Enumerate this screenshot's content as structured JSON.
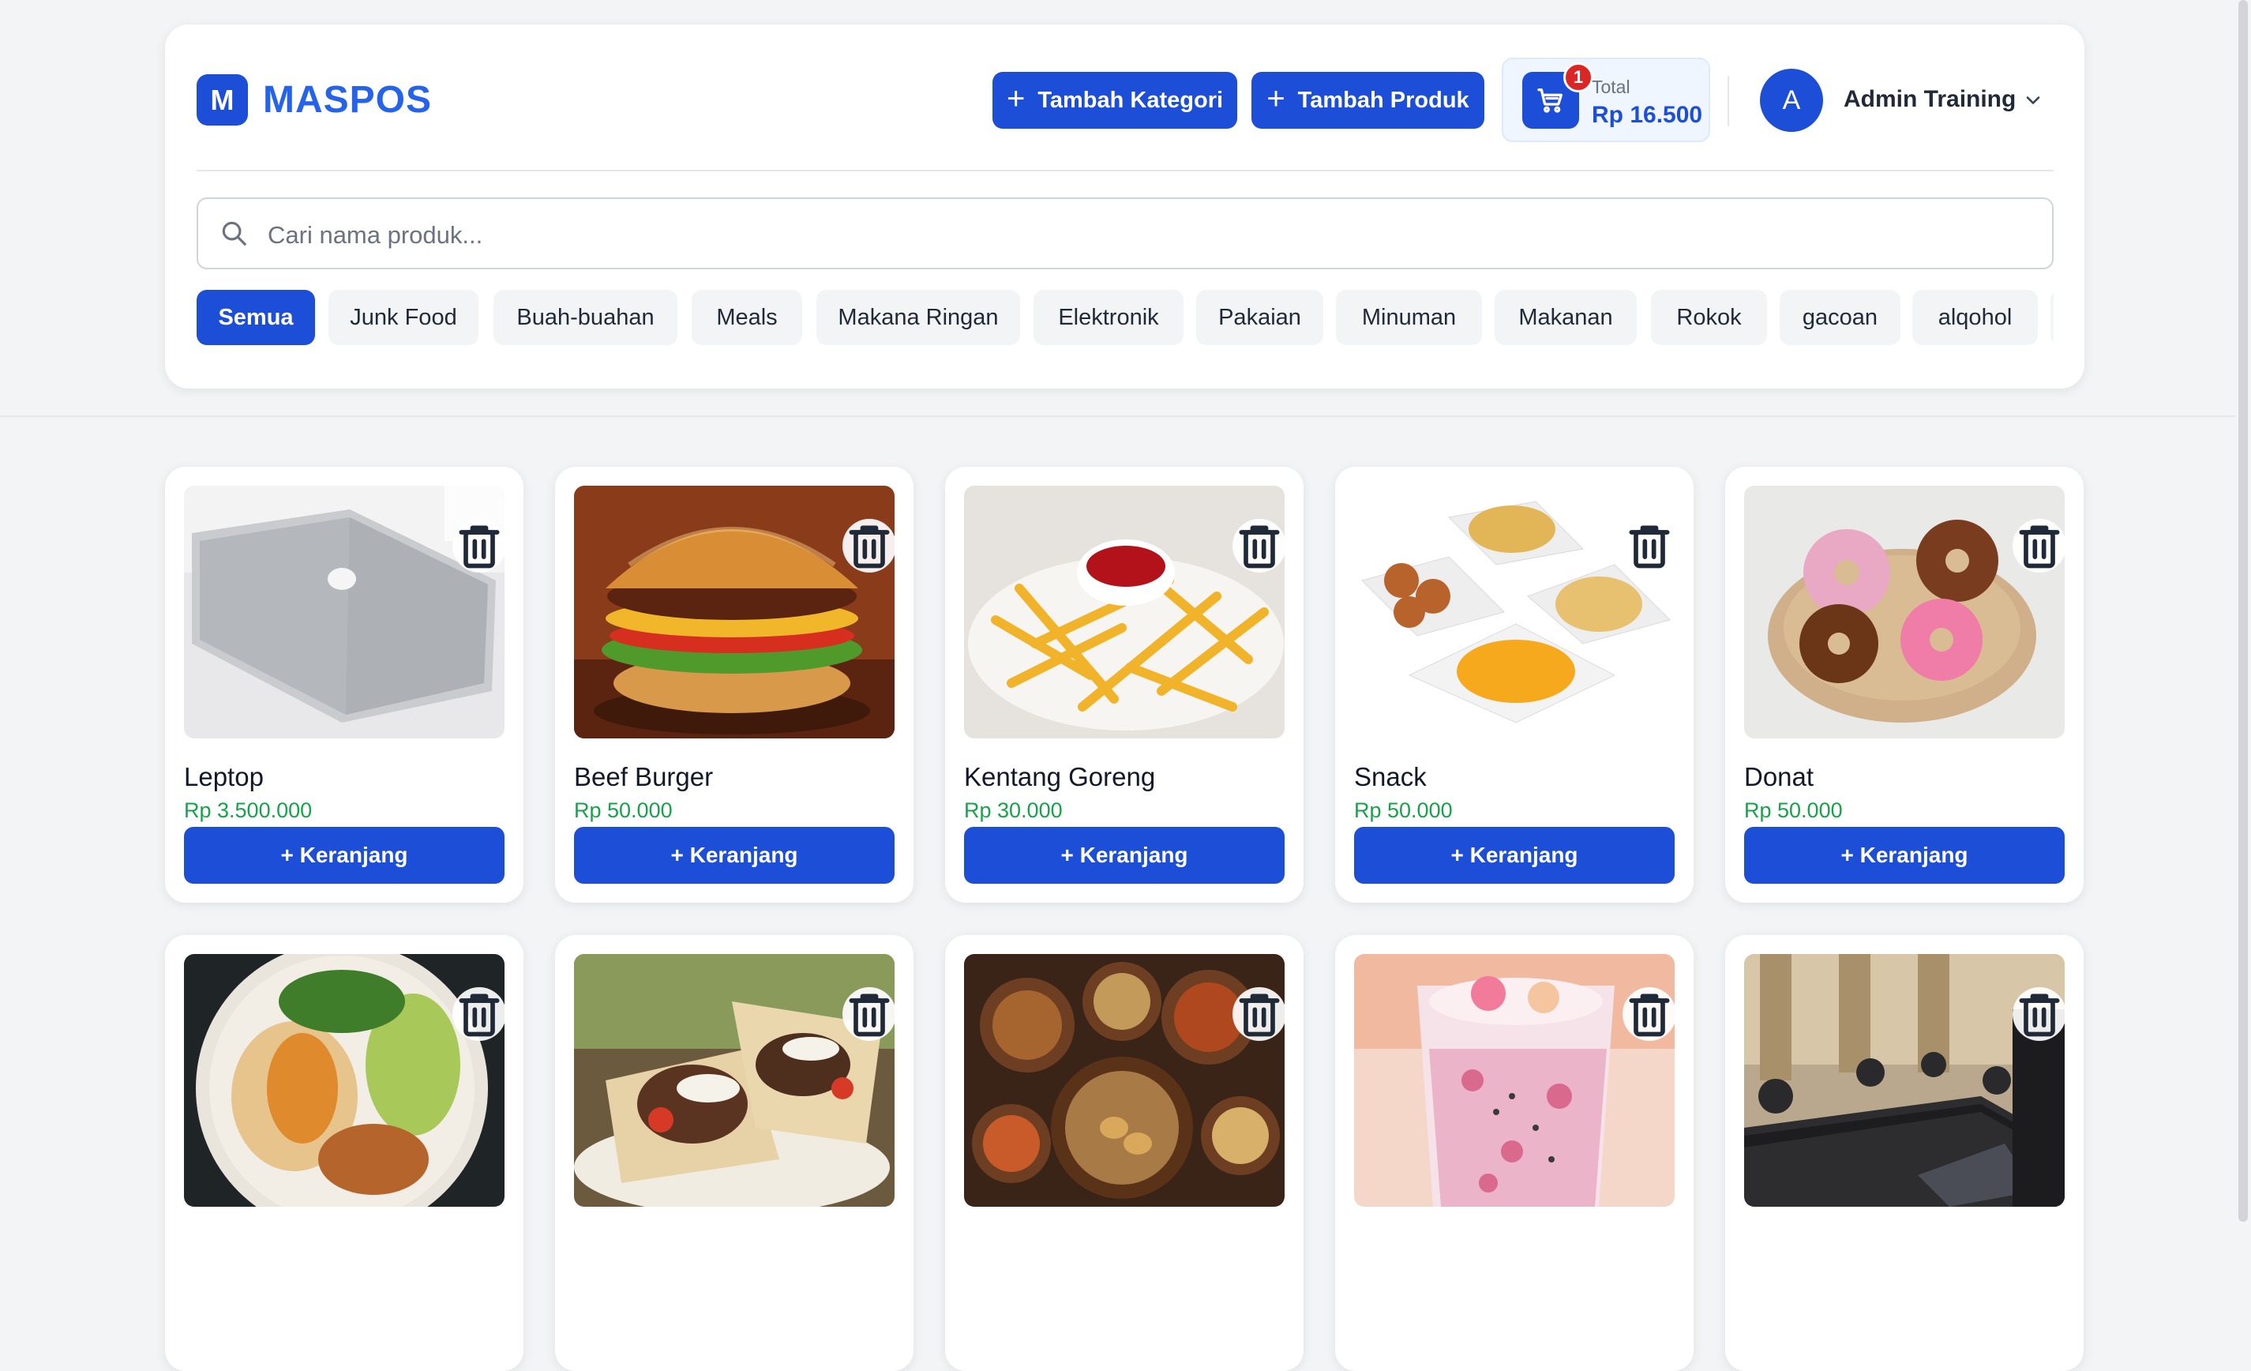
{
  "app": {
    "logo_letter": "M",
    "name": "MASPOS"
  },
  "header": {
    "add_category_label": "Tambah Kategori",
    "add_product_label": "Tambah Produk",
    "cart": {
      "badge": "1",
      "total_label": "Total",
      "total_value": "Rp 16.500"
    },
    "user": {
      "initial": "A",
      "name": "Admin Training"
    }
  },
  "search": {
    "placeholder": "Cari nama produk..."
  },
  "categories": [
    {
      "label": "Semua",
      "active": true
    },
    {
      "label": "Junk Food"
    },
    {
      "label": "Buah-buahan"
    },
    {
      "label": "Meals"
    },
    {
      "label": "Makana Ringan"
    },
    {
      "label": "Elektronik"
    },
    {
      "label": "Pakaian"
    },
    {
      "label": "Minuman"
    },
    {
      "label": "Makanan"
    },
    {
      "label": "Rokok"
    },
    {
      "label": "gacoan"
    },
    {
      "label": "alqohol"
    }
  ],
  "products": [
    {
      "name": "Leptop",
      "price": "Rp 3.500.000",
      "button": "+ Keranjang",
      "image": "laptop"
    },
    {
      "name": "Beef Burger",
      "price": "Rp 50.000",
      "button": "+ Keranjang",
      "image": "burger"
    },
    {
      "name": "Kentang Goreng",
      "price": "Rp 30.000",
      "button": "+ Keranjang",
      "image": "fries"
    },
    {
      "name": "Snack",
      "price": "Rp 50.000",
      "button": "+ Keranjang",
      "image": "snack"
    },
    {
      "name": "Donat",
      "price": "Rp 50.000",
      "button": "+ Keranjang",
      "image": "donut"
    },
    {
      "image": "salad-bowl"
    },
    {
      "image": "wrap"
    },
    {
      "image": "rice-dishes"
    },
    {
      "image": "drink"
    },
    {
      "image": "meeting-room"
    }
  ],
  "colors": {
    "primary": "#1d4ed8",
    "price_green": "#16a34a",
    "badge_red": "#dc2626"
  }
}
